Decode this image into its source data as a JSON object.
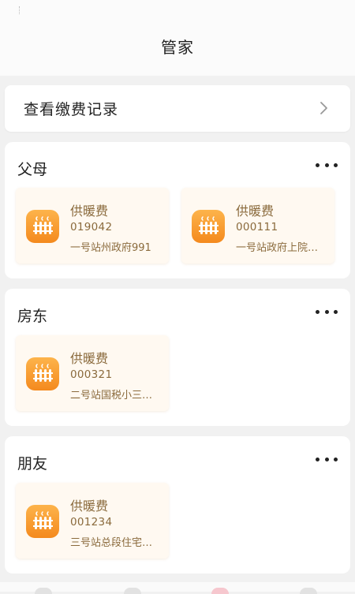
{
  "header": {
    "title": "管家"
  },
  "records": {
    "label": "查看缴费记录"
  },
  "groups": [
    {
      "title": "父母",
      "cards": [
        {
          "title": "供暖费",
          "code": "019042",
          "address": "一号站州政府991"
        },
        {
          "title": "供暖费",
          "code": "000111",
          "address": "一号站政府上院…"
        }
      ]
    },
    {
      "title": "房东",
      "cards": [
        {
          "title": "供暖费",
          "code": "000321",
          "address": "二号站国税小三…"
        }
      ]
    },
    {
      "title": "朋友",
      "cards": [
        {
          "title": "供暖费",
          "code": "001234",
          "address": "三号站总段住宅…"
        }
      ]
    }
  ],
  "icons": {
    "records": "chevron-right-icon",
    "group_menu": "more-horizontal-icon",
    "card": "heating-radiator-icon"
  },
  "colors": {
    "icon_gradient_top": "#fdb44b",
    "icon_gradient_bottom": "#f48a1e",
    "card_background": "#fff9f1",
    "card_text": "#8a6a3c",
    "tab_active": "#e8384f"
  }
}
